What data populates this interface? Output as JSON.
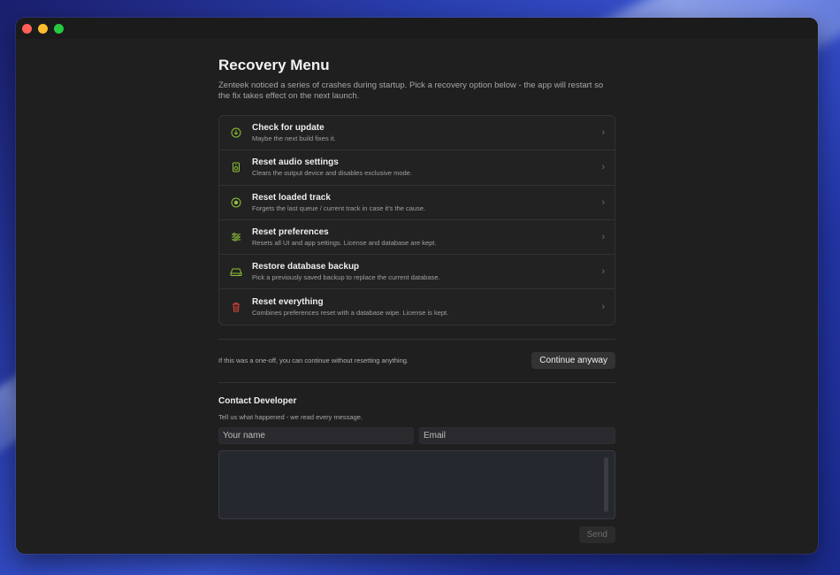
{
  "window": {
    "controls": [
      "close",
      "minimize",
      "zoom"
    ]
  },
  "header": {
    "title": "Recovery Menu",
    "description": "Zenteek noticed a series of crashes during startup. Pick a recovery option below - the app will restart so the fix takes effect on the next launch."
  },
  "options": [
    {
      "title": "Check for update",
      "subtitle": "Maybe the next build fixes it.",
      "icon": "download-icon",
      "color": "#8fc33a"
    },
    {
      "title": "Reset audio settings",
      "subtitle": "Clears the output device and disables exclusive mode.",
      "icon": "speaker-icon",
      "color": "#8fc33a"
    },
    {
      "title": "Reset loaded track",
      "subtitle": "Forgets the last queue / current track in case it's the cause.",
      "icon": "record-icon",
      "color": "#8fc33a"
    },
    {
      "title": "Reset preferences",
      "subtitle": "Resets all UI and app settings. License and database are kept.",
      "icon": "sliders-icon",
      "color": "#8fc33a"
    },
    {
      "title": "Restore database backup",
      "subtitle": "Pick a previously saved backup to replace the current database.",
      "icon": "drive-icon",
      "color": "#8fc33a"
    },
    {
      "title": "Reset everything",
      "subtitle": "Combines preferences reset with a database wipe. License is kept.",
      "icon": "trash-icon",
      "color": "#e0443c"
    }
  ],
  "continue": {
    "text": "If this was a one-off, you can continue without resetting anything.",
    "button_label": "Continue anyway"
  },
  "contact": {
    "title": "Contact Developer",
    "subtitle": "Tell us what happened - we read every message.",
    "name_placeholder": "Your name",
    "email_placeholder": "Email",
    "message_value": "",
    "send_label": "Send"
  },
  "colors": {
    "accent": "#8fc33a",
    "danger": "#e0443c"
  }
}
